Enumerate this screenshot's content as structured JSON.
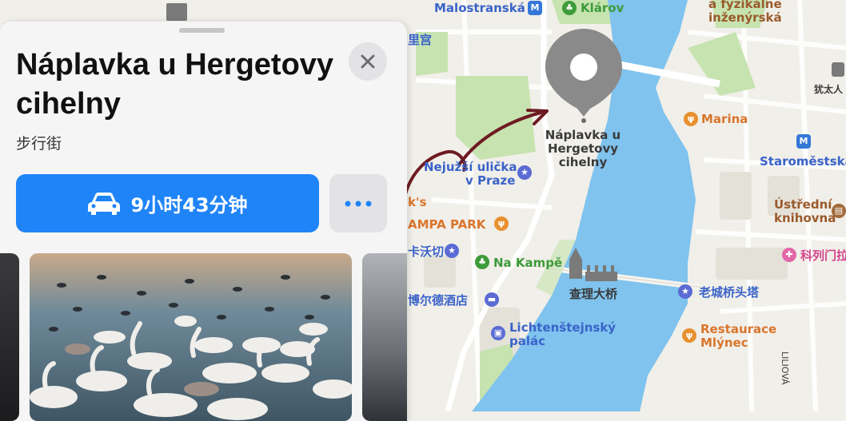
{
  "place": {
    "title": "Náplavka u Hergetovy cihelny",
    "subtitle": "步行街"
  },
  "actions": {
    "drive_time": "9小时43分钟",
    "close_icon": "close-icon",
    "more_icon": "ellipsis-icon",
    "car_icon": "car-icon"
  },
  "photos": {
    "main_icon": "swans-photo"
  },
  "map": {
    "pin_label": "Náplavka u\nHergetovy\ncihelny",
    "labels": {
      "malostranska": "Malostranská",
      "klarov": "Klárov",
      "fyzikalni": "a fyzikálne",
      "inzenyrska": "inženýrská",
      "palace_cn": "里宫",
      "jewish_cn": "犹太人",
      "marina": "Marina",
      "staromestska": "Staroměstská",
      "nejuzsi_1": "Nejužší ulička",
      "nejuzsi_2": "v Praze",
      "ks": "k's",
      "kampa_park": "AMPA PARK",
      "kafka_cn": "卡沃切",
      "na_kampe": "Na Kampě",
      "charles_bridge_cn": "查理大桥",
      "hotel_cn": "博尔德酒店",
      "lichtenstejnsky_1": "Lichtenštejnský",
      "lichtenstejnsky_2": "palác",
      "ustredni_1": "Ústřední",
      "ustredni_2": "knihovna",
      "science_cn": "科列门拉",
      "old_town_tower_cn": "老城桥头塔",
      "restaurace_1": "Restaurace",
      "restaurace_2": "Mlýnec",
      "liliova": "LILIOVÁ"
    }
  },
  "colors": {
    "accent": "#1f84f8",
    "water": "#7fc3ee",
    "park": "#c7e3b0",
    "land": "#f1efe9",
    "pin": "#8a8a8a",
    "arrow": "#6e1a22"
  }
}
